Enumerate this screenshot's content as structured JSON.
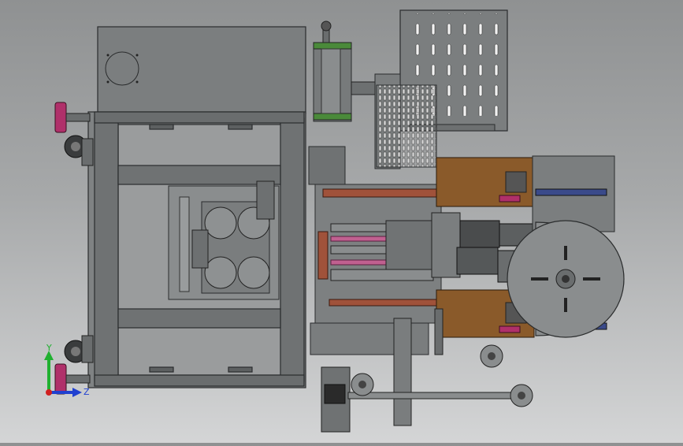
{
  "viewport": {
    "background_top": "#8f9192",
    "background_bottom": "#d4d5d6",
    "body_color": "#7a7d7e",
    "frame_color": "#5a5d5e",
    "plate_brown": "#8a5a2a",
    "rod_red": "#a0523a",
    "accent_magenta": "#b0306a",
    "gear_green": "#4a8a3a",
    "edge_color": "#2a2c2d"
  },
  "triad": {
    "x_label": "Z",
    "y_label": "Y",
    "x_color": "#2040d0",
    "y_color": "#20b030",
    "origin_color": "#d02020"
  }
}
